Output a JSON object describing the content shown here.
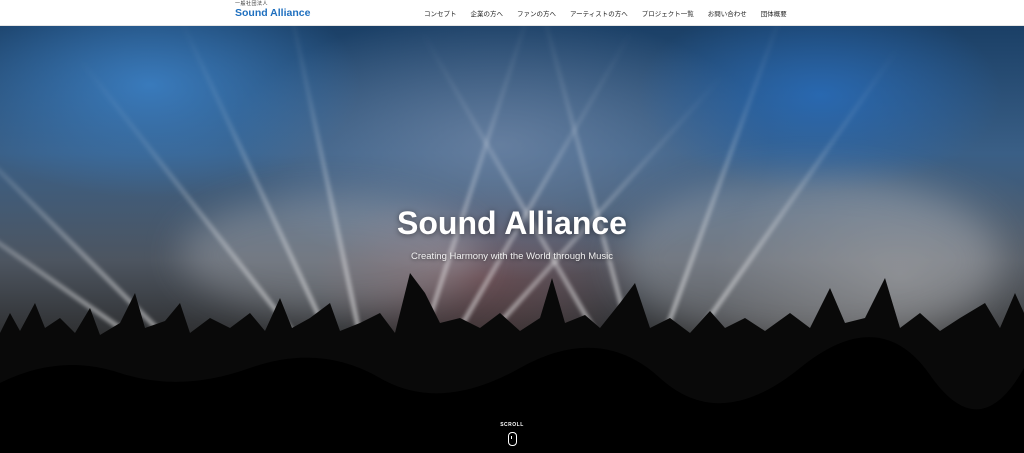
{
  "header": {
    "logo_sub": "一般社団法人",
    "logo_main": "Sound Alliance",
    "nav": [
      {
        "label": "コンセプト"
      },
      {
        "label": "企業の方へ"
      },
      {
        "label": "ファンの方へ"
      },
      {
        "label": "アーティストの方へ"
      },
      {
        "label": "プロジェクト一覧"
      },
      {
        "label": "お問い合わせ"
      },
      {
        "label": "団体概要"
      }
    ]
  },
  "hero": {
    "title": "Sound Alliance",
    "subtitle": "Creating Harmony with the World through Music",
    "image_icon": "concert-crowd-image",
    "scroll_label": "SCROLL",
    "scroll_icon": "mouse-scroll-icon"
  },
  "colors": {
    "brand": "#1e6fbf",
    "header_bg": "#ffffff"
  }
}
